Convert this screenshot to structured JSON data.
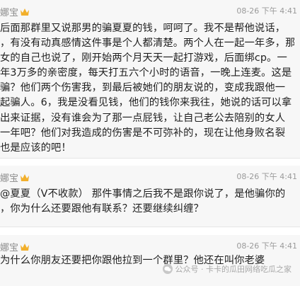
{
  "comments": [
    {
      "name": "娜宝",
      "date": "08-26",
      "time": "下午 4:41",
      "lines": [
        "后面那群里又说那男的骗夏夏的钱，呵呵了。我不是帮他说话，",
        "，有没有动真感情这件事是个人都清楚。两个人在一起一年多，那",
        "女的自己也说了，刚开始两个月天天一起打游戏，后面绑cp。一",
        "年3万多的亲密度，每天打五六个小时的语音，一晚上连麦。这是",
        "骗？他们两个伤害我，到最后被她们的朋友说的，变成我跟他一",
        "起骗人。6，我是没看见钱，他们的钱你来我往，她说的话可以拿",
        "出来证据，没有谁会为了那一点屁钱，让自己老公去陪别的女人",
        "一年吧？他们对我造成的伤害是不可弥补的，现在让他身败名裂",
        "也是应该的吧！"
      ]
    },
    {
      "name": "娜宝",
      "date": "08-26",
      "time": "下午 4:41",
      "lines": [
        "@夏夏（V不收款） 那件事情之后我不是跟你说了，是他骗你的",
        "，你为什么还要跟他有联系？还要继续纠缠？"
      ]
    },
    {
      "name": "娜宝",
      "date": "08-26",
      "time": "下午 4:41",
      "lines": [
        "为什么你朋友还要把你跟他拉到一个群里？他还在叫你老婆"
      ]
    }
  ],
  "watermark": "公众号 · 卡卡的瓜田网络吃瓜之家",
  "icons": {
    "crown": "crown-icon",
    "watermark": "wechat-icon"
  },
  "colors": {
    "card_bg": "#f7f7f7",
    "name": "#8b8b8b",
    "meta": "#9a9a9a",
    "crown": "#f2b02c"
  }
}
